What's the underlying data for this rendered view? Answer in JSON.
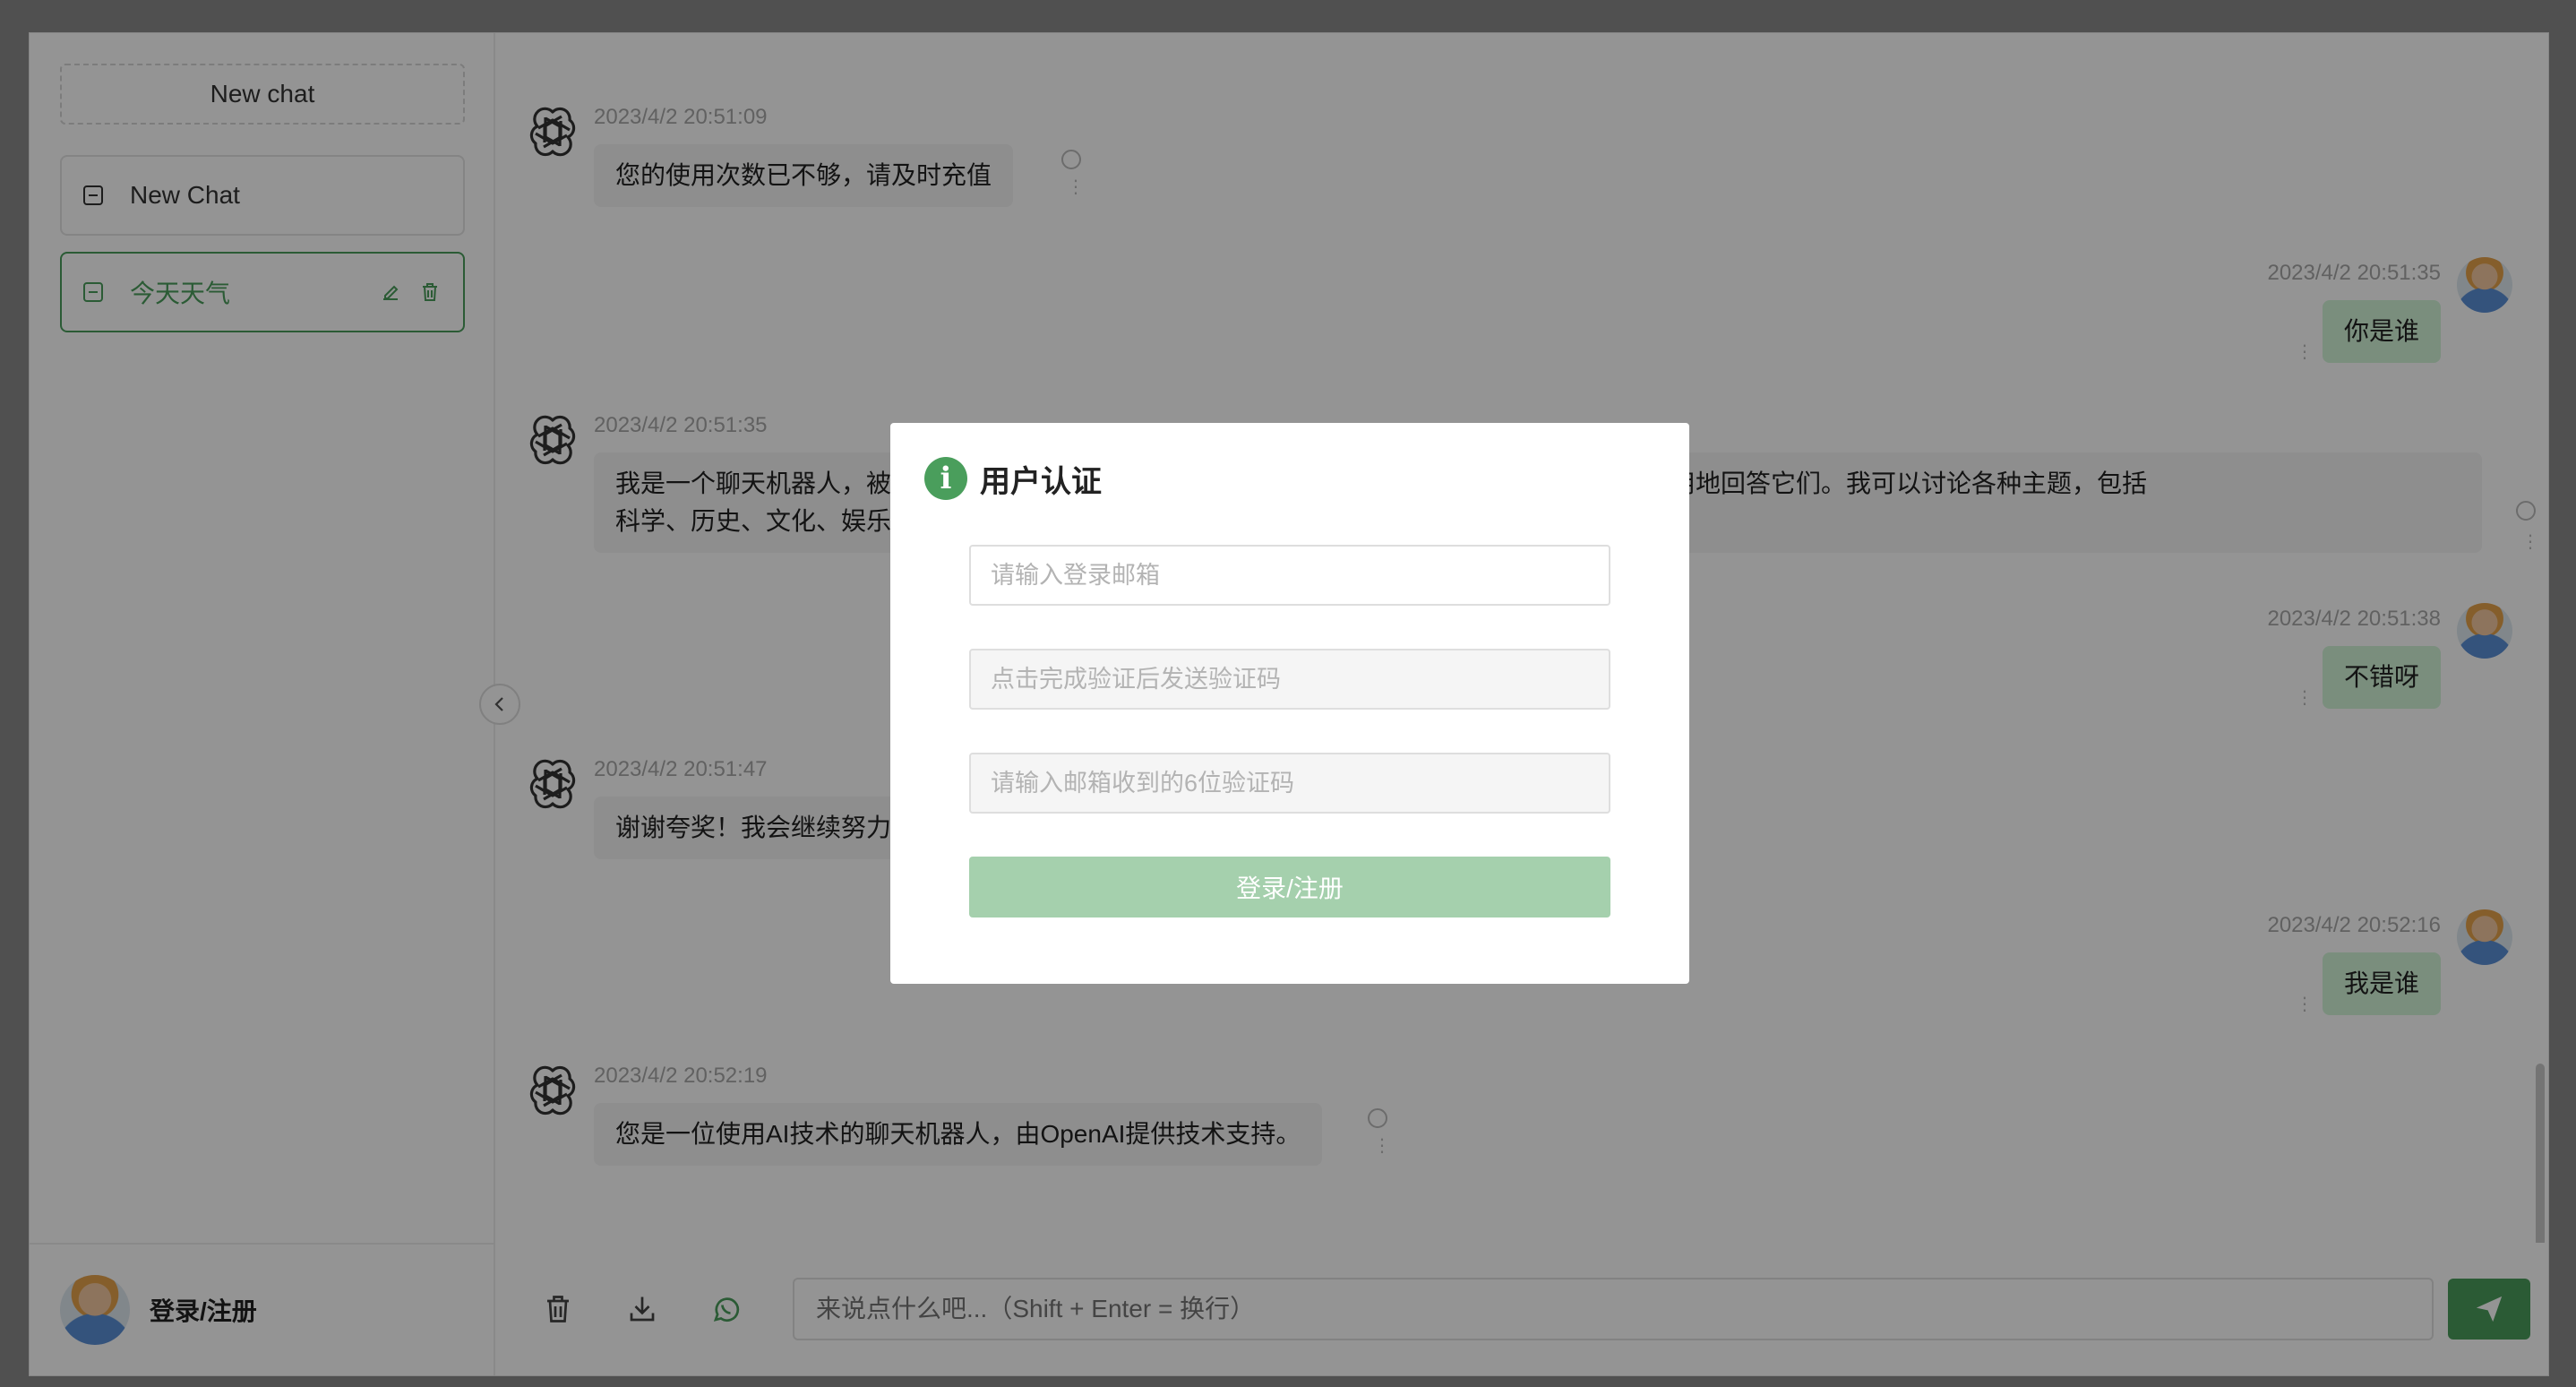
{
  "sidebar": {
    "new_chat_button": "New chat",
    "history": [
      {
        "label": "New Chat",
        "active": false
      },
      {
        "label": "今天天气",
        "active": true
      }
    ],
    "footer": {
      "login_label": "登录/注册"
    }
  },
  "messages": [
    {
      "role": "bot",
      "time": "2023/4/2 20:51:09",
      "text": "您的使用次数已不够，请及时充值"
    },
    {
      "role": "user",
      "time": "2023/4/2 20:51:35",
      "text": "你是谁"
    },
    {
      "role": "bot",
      "time": "2023/4/2 20:51:35",
      "text_line1": "我是一个聊天机器人，被",
      "text_line1_right": "问题，并尽可能准确和有用地回答它们。我可以讨论各种主题，包括",
      "text_line2": "科学、历史、文化、娱乐"
    },
    {
      "role": "user",
      "time": "2023/4/2 20:51:38",
      "text": "不错呀"
    },
    {
      "role": "bot",
      "time": "2023/4/2 20:51:47",
      "text": "谢谢夸奖！我会继续努力"
    },
    {
      "role": "user",
      "time": "2023/4/2 20:52:16",
      "text": "我是谁"
    },
    {
      "role": "bot",
      "time": "2023/4/2 20:52:19",
      "text": "您是一位使用AI技术的聊天机器人，由OpenAI提供技术支持。"
    }
  ],
  "input": {
    "placeholder": "来说点什么吧...（Shift + Enter = 换行）"
  },
  "modal": {
    "title": "用户认证",
    "email_placeholder": "请输入登录邮箱",
    "captcha_placeholder": "点击完成验证后发送验证码",
    "code_placeholder": "请输入邮箱收到的6位验证码",
    "submit_label": "登录/注册"
  },
  "colors": {
    "accent": "#4a9e5c",
    "accent_disabled": "#a5d0ad",
    "user_bubble": "#d2f5d8",
    "bot_bubble": "#f4f4f5"
  },
  "icons": {
    "bot_avatar": "openai-logo-icon",
    "chat": "chat-icon",
    "edit": "edit-icon",
    "delete": "trash-icon",
    "collapse": "chevron-left-icon",
    "clear": "trash-icon",
    "download": "download-icon",
    "whatsapp": "whatsapp-icon",
    "send": "send-icon",
    "info": "info-icon"
  }
}
